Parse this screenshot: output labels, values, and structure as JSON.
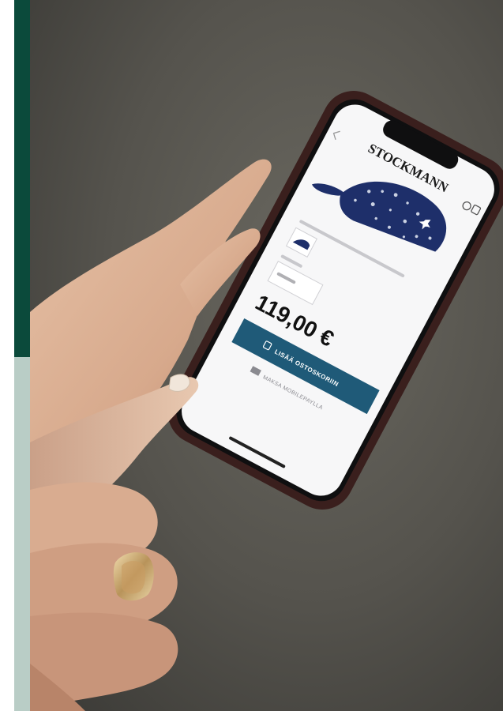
{
  "photo": {
    "brand_logo": "STOCKMANN",
    "price": "119,00 €",
    "primary_button_label": "LISÄÄ OSTOSKORIIN",
    "secondary_button_label": "MAKSA MOBILEPAYLLA"
  },
  "colors": {
    "band_top": "#0b4a3b",
    "band_bottom": "#b9cdc6",
    "backdrop": "#5a5852",
    "phone_case": "#3a1f1d",
    "button_blue": "#1f5a78",
    "cap_navy": "#1e2f6a"
  }
}
